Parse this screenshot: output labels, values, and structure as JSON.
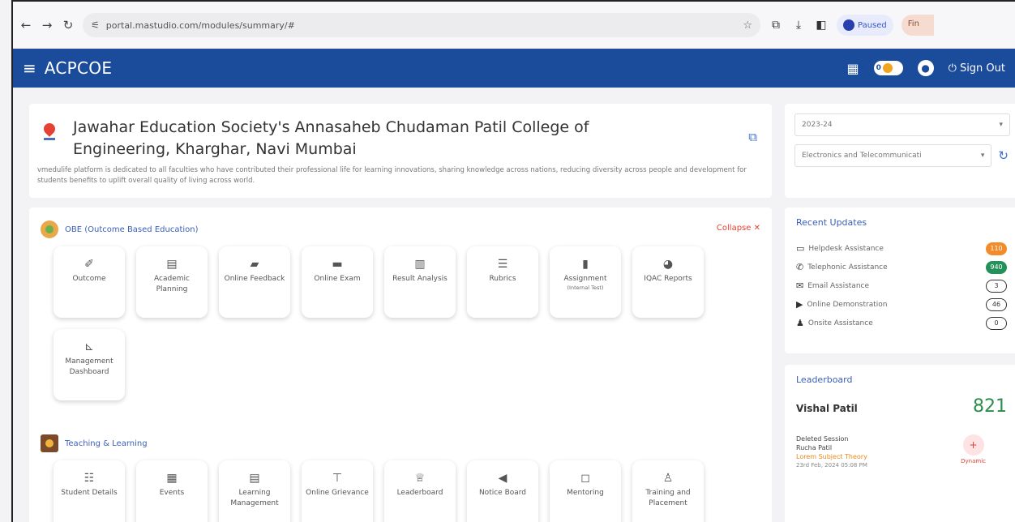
{
  "browser": {
    "url": "portal.mastudio.com/modules/summary/#",
    "paused_label": "Paused",
    "other_label": "Fin"
  },
  "app": {
    "brand": "ACPCOE",
    "toggle_count": "0",
    "signout_label": "Sign Out"
  },
  "college": {
    "name_line1": "Jawahar Education Society's Annasaheb Chudaman Patil College of",
    "name_line2": "Engineering, Kharghar, Navi Mumbai",
    "description": "vmedulife platform is dedicated to all faculties who have contributed their professional life for learning innovations, sharing knowledge across nations, reducing diversity across people and development for students benefits to uplift overall quality of living across world."
  },
  "filters": {
    "year": "2023-24",
    "department": "Electronics and Telecommunicati"
  },
  "obe": {
    "title": "OBE (Outcome Based Education)",
    "collapse_label": "Collapse",
    "tiles": [
      {
        "label": "Outcome",
        "icon": "✐"
      },
      {
        "label": "Academic Planning",
        "icon": "▤"
      },
      {
        "label": "Online Feedback",
        "icon": "▰"
      },
      {
        "label": "Online Exam",
        "icon": "▬"
      },
      {
        "label": "Result Analysis",
        "icon": "▥"
      },
      {
        "label": "Rubrics",
        "icon": "☰"
      },
      {
        "label": "Assignment",
        "sub": "(Internal Test)",
        "icon": "▮"
      },
      {
        "label": "IQAC Reports",
        "icon": "◕"
      },
      {
        "label": "Management Dashboard",
        "icon": "⊾"
      }
    ]
  },
  "teaching": {
    "title": "Teaching & Learning",
    "tiles": [
      {
        "label": "Student Details",
        "icon": "☷"
      },
      {
        "label": "Events",
        "icon": "▦"
      },
      {
        "label": "Learning Management",
        "icon": "▤"
      },
      {
        "label": "Online Grievance",
        "icon": "⊤"
      },
      {
        "label": "Leaderboard",
        "icon": "♕"
      },
      {
        "label": "Notice Board",
        "icon": "◀"
      },
      {
        "label": "Mentoring",
        "icon": "◻"
      },
      {
        "label": "Training and Placement",
        "icon": "♙"
      }
    ]
  },
  "updates": {
    "title": "Recent Updates",
    "items": [
      {
        "label": "Helpdesk Assistance",
        "icon": "▭",
        "count": "110",
        "style": "orange"
      },
      {
        "label": "Telephonic Assistance",
        "icon": "✆",
        "count": "940",
        "style": "green"
      },
      {
        "label": "Email Assistance",
        "icon": "✉",
        "count": "3",
        "style": "outline"
      },
      {
        "label": "Online Demonstration",
        "icon": "▶",
        "count": "46",
        "style": "outline"
      },
      {
        "label": "Onsite Assistance",
        "icon": "♟",
        "count": "0",
        "style": "outline"
      }
    ]
  },
  "leaderboard": {
    "title": "Leaderboard",
    "leader_name": "Vishal Patil",
    "leader_score": "821",
    "entry_title": "Deleted Session",
    "entry_name": "Rucha Patil",
    "entry_course": "Lorem Subject Theory",
    "entry_date": "23rd Feb, 2024 05:08 PM",
    "entry_tag": "Dynamic"
  }
}
